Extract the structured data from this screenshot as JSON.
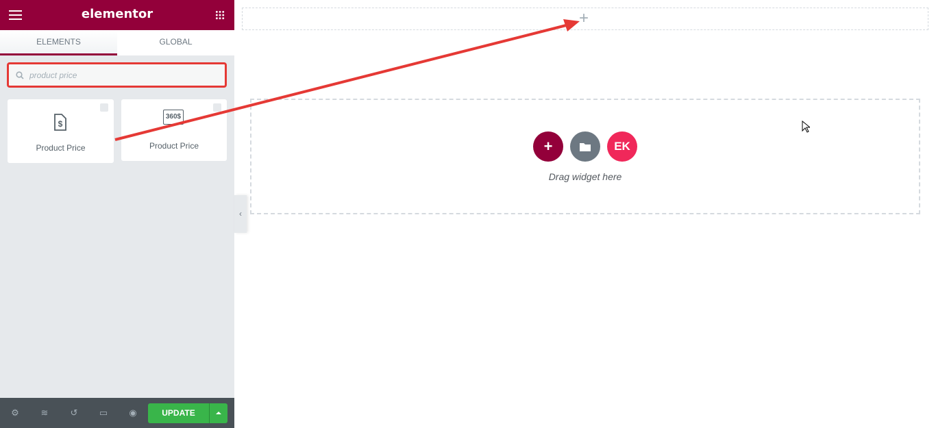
{
  "header": {
    "logo": "elementor",
    "menu_icon": "hamburger-icon",
    "apps_icon": "grid-icon"
  },
  "tabs": [
    {
      "label": "ELEMENTS",
      "active": true
    },
    {
      "label": "GLOBAL",
      "active": false
    }
  ],
  "search": {
    "value": "product price",
    "icon": "search-icon"
  },
  "widgets": [
    {
      "label": "Product Price",
      "icon": "product-price-icon",
      "badge": "woocommerce-icon"
    },
    {
      "label": "Product Price",
      "icon": "360-price-icon",
      "icon_text": "360$",
      "badge": "lock-icon"
    }
  ],
  "footer": {
    "update_label": "UPDATE",
    "icons": [
      "settings-icon",
      "layers-icon",
      "history-icon",
      "responsive-icon",
      "preview-icon"
    ]
  },
  "canvas": {
    "drag_text": "Drag widget here",
    "add_icon": "+",
    "colors": {
      "add": "#93003a",
      "template": "#6d7882",
      "ek": "#f0285a",
      "annotation": "#e53935"
    }
  }
}
